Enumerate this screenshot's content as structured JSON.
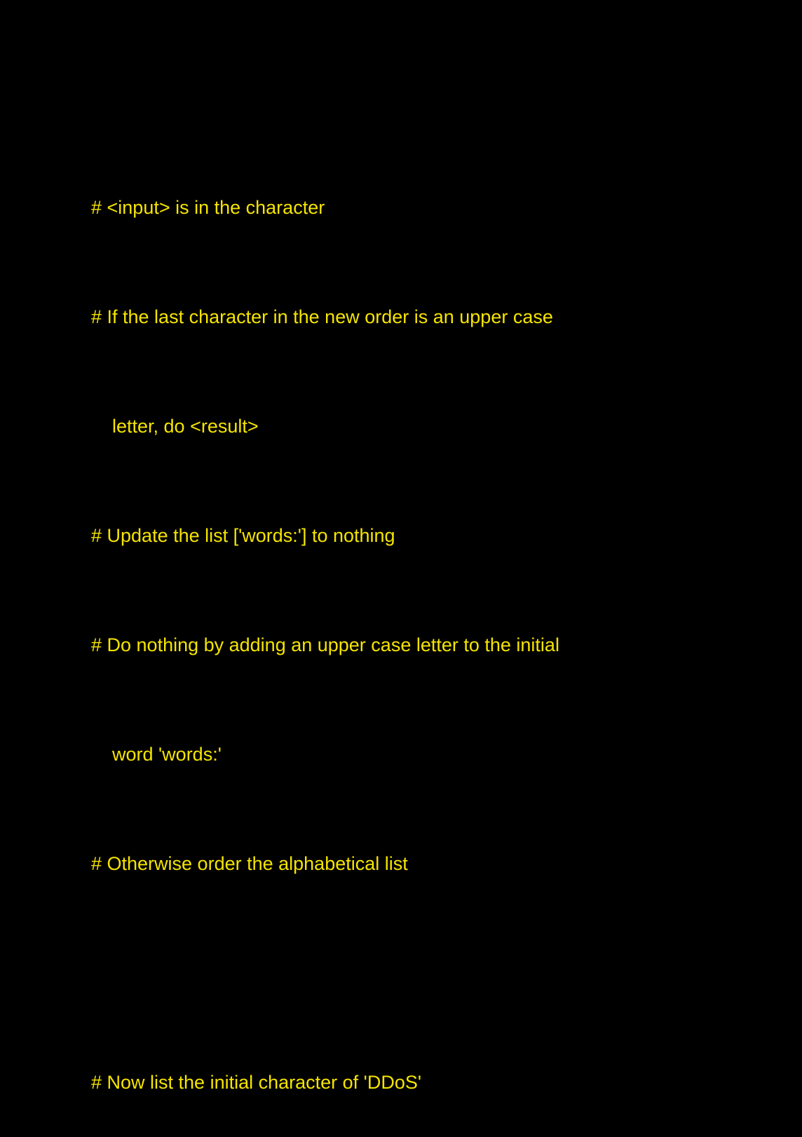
{
  "colors": {
    "background": "#000000",
    "text": "#f5e400"
  },
  "lines": [
    {
      "text": "# <input> is in the character"
    },
    {
      "text": "# If the last character in the new order is an upper case"
    },
    {
      "text": "letter, do <result>"
    },
    {
      "text": "# Update the list ['words:'] to nothing"
    },
    {
      "text": "# Do nothing by adding an upper case letter to the initial"
    },
    {
      "text": "word 'words:'"
    },
    {
      "text": "# Otherwise order the alphabetical list"
    },
    {
      "text": ""
    },
    {
      "text": "# Now list the initial character of 'DDoS'"
    }
  ]
}
